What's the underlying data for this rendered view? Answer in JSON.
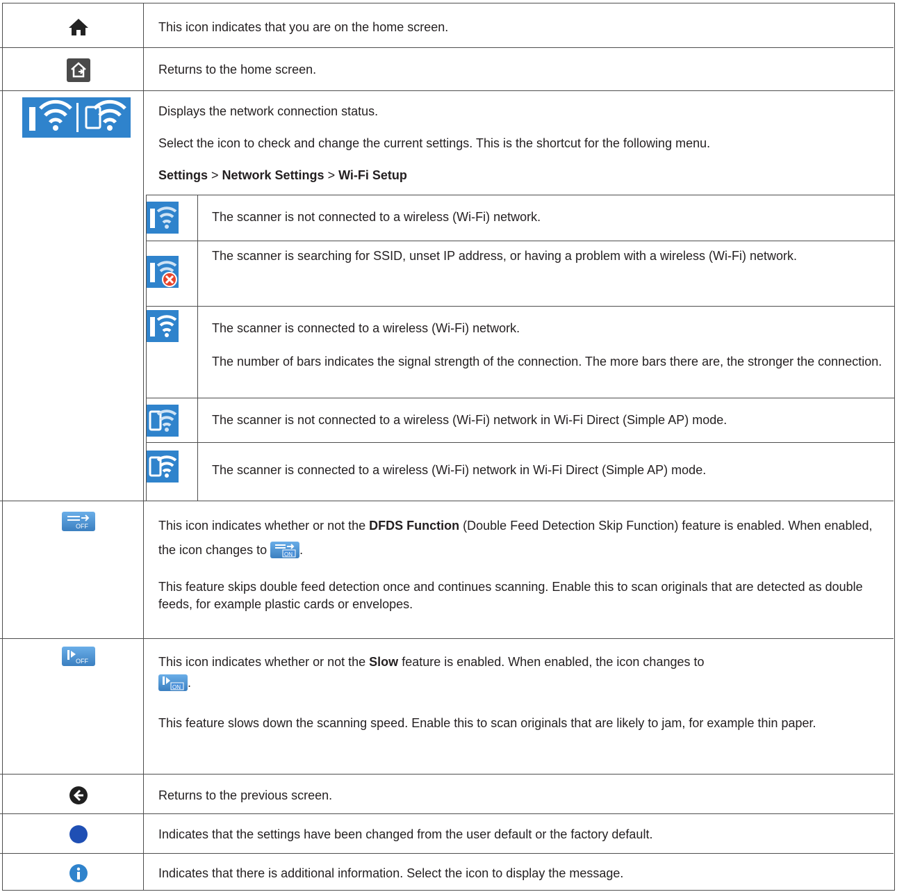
{
  "rows": {
    "home": {
      "icon": "home-icon",
      "text": "This icon indicates that you are on the home screen."
    },
    "home_btn": {
      "icon": "return-home-icon",
      "text": "Returns to the home screen."
    },
    "network": {
      "icon": "network-status-icon",
      "p1": "Displays the network connection status.",
      "p2": "Select the icon to check and change the current settings. This is the shortcut for the following menu.",
      "path_settings": "Settings",
      "path_sep1": " > ",
      "path_network": "Network Settings",
      "path_sep2": " > ",
      "path_wifi": "Wi-Fi Setup",
      "sub": [
        {
          "icon": "wifi-disconnected-icon",
          "text": "The scanner is not connected to a wireless (Wi-Fi) network."
        },
        {
          "icon": "wifi-error-icon",
          "text": "The scanner is searching for SSID, unset IP address, or having a problem with a wireless (Wi-Fi) network."
        },
        {
          "icon": "wifi-connected-icon",
          "text": "The scanner is connected to a wireless (Wi-Fi) network.",
          "text2": "The number of bars indicates the signal strength of the connection. The more bars there are, the stronger the connection."
        },
        {
          "icon": "wifi-direct-disconnected-icon",
          "text": "The scanner is not connected to a wireless (Wi-Fi) network in Wi-Fi Direct (Simple AP) mode."
        },
        {
          "icon": "wifi-direct-connected-icon",
          "text": "The scanner is connected to a wireless (Wi-Fi) network in Wi-Fi Direct (Simple AP) mode."
        }
      ]
    },
    "dfds": {
      "icon": "dfds-off-icon",
      "t1": "This icon indicates whether or not the ",
      "t_bold": "DFDS Function",
      "t2": " (Double Feed Detection Skip Function) feature is enabled. When enabled, the icon changes to ",
      "t3": ".",
      "p2": "This feature skips double feed detection once and continues scanning. Enable this to scan originals that are detected as double feeds, for example plastic cards or envelopes.",
      "off_label": "OFF",
      "on_label": "ON"
    },
    "slow": {
      "icon": "slow-off-icon",
      "t1": "This icon indicates whether or not the ",
      "t_bold": "Slow",
      "t2": " feature is enabled. When enabled, the icon changes to ",
      "t3": ".",
      "p2": "This feature slows down the scanning speed. Enable this to scan originals that are likely to jam, for example thin paper.",
      "off_label": "OFF",
      "on_label": "ON"
    },
    "back": {
      "icon": "back-arrow-icon",
      "text": "Returns to the previous screen."
    },
    "changed": {
      "icon": "blue-dot-icon",
      "text": "Indicates that the settings have been changed from the user default or the factory default."
    },
    "info": {
      "icon": "info-icon",
      "text": "Indicates that there is additional information. Select the icon to display the message."
    }
  }
}
